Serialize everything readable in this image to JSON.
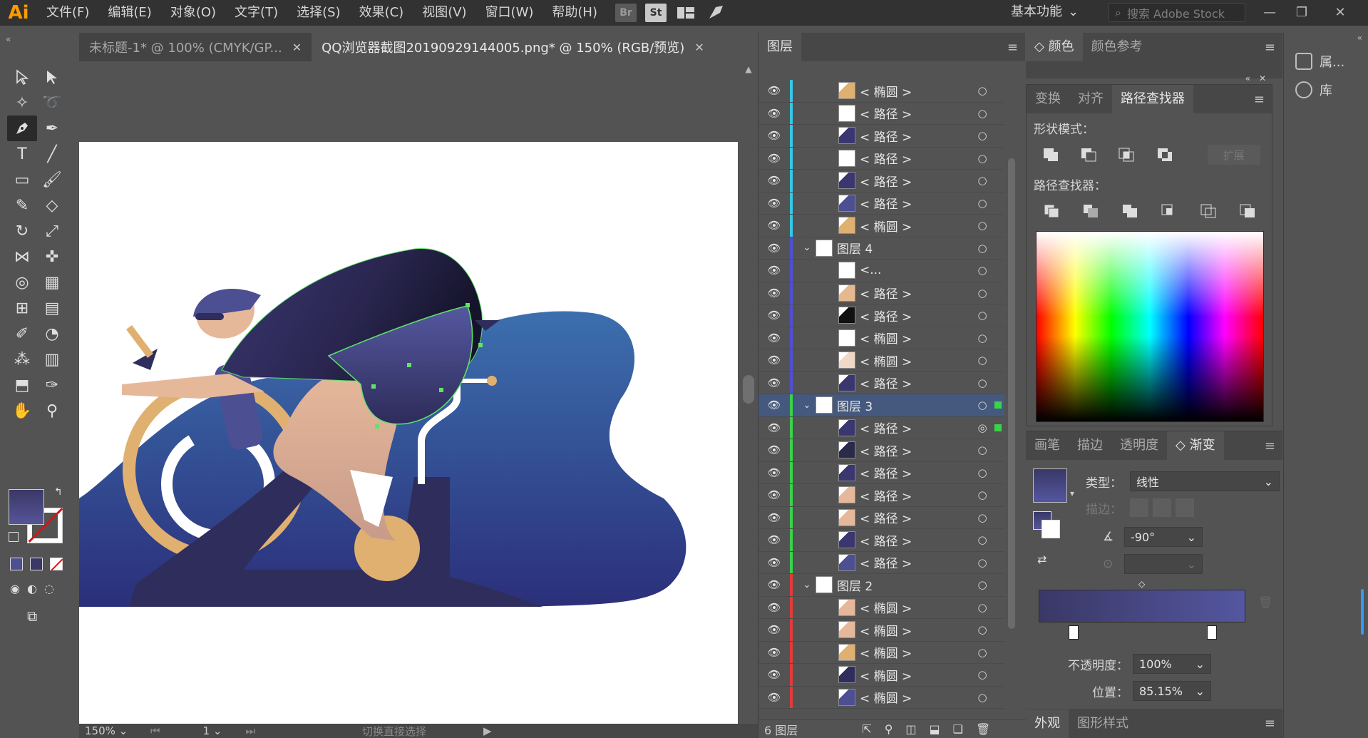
{
  "app": {
    "logo": "Ai"
  },
  "menu": [
    "文件(F)",
    "编辑(E)",
    "对象(O)",
    "文字(T)",
    "选择(S)",
    "效果(C)",
    "视图(V)",
    "窗口(W)",
    "帮助(H)"
  ],
  "menubar_icons": {
    "br": "Br",
    "st": "St"
  },
  "workspace": {
    "label": "基本功能"
  },
  "search": {
    "placeholder": "搜索 Adobe Stock"
  },
  "tabs": [
    {
      "label": "未标题-1* @ 100% (CMYK/GP...",
      "active": false
    },
    {
      "label": "QQ浏览器截图20190929144005.png* @ 150% (RGB/预览)",
      "active": true
    }
  ],
  "status": {
    "zoom": "150%",
    "page": "1",
    "text": "切换直接选择"
  },
  "layers_panel": {
    "title": "图层",
    "count": "6 图层",
    "rows": [
      {
        "name": "< 椭圆 >",
        "color": "#35c7e6",
        "thumb": "#e0b070",
        "level": 2
      },
      {
        "name": "< 路径 >",
        "color": "#35c7e6",
        "thumb": "#ffffff",
        "level": 2
      },
      {
        "name": "< 路径 >",
        "color": "#35c7e6",
        "thumb": "#3a3670",
        "level": 2
      },
      {
        "name": "< 路径 >",
        "color": "#35c7e6",
        "thumb": "#ffffff",
        "level": 2
      },
      {
        "name": "< 路径 >",
        "color": "#35c7e6",
        "thumb": "#3a3670",
        "level": 2
      },
      {
        "name": "< 路径 >",
        "color": "#35c7e6",
        "thumb": "#4c4f92",
        "level": 2
      },
      {
        "name": "< 椭圆 >",
        "color": "#35c7e6",
        "thumb": "#e0b070",
        "level": 2
      },
      {
        "name": "图层 4",
        "color": "#4f4fd6",
        "thumb": "#ffffff",
        "level": 1,
        "expanded": true
      },
      {
        "name": "<...",
        "color": "#4f4fd6",
        "thumb": "#ffffff",
        "level": 2
      },
      {
        "name": "< 路径 >",
        "color": "#4f4fd6",
        "thumb": "#e6b890",
        "level": 2
      },
      {
        "name": "< 路径 >",
        "color": "#4f4fd6",
        "thumb": "#111111",
        "level": 2
      },
      {
        "name": "< 椭圆 >",
        "color": "#4f4fd6",
        "thumb": "#ffffff",
        "level": 2
      },
      {
        "name": "< 椭圆 >",
        "color": "#4f4fd6",
        "thumb": "#f0d8c8",
        "level": 2
      },
      {
        "name": "< 路径 >",
        "color": "#4f4fd6",
        "thumb": "#3a3670",
        "level": 2
      },
      {
        "name": "图层 3",
        "color": "#39d24a",
        "thumb": "#ffffff",
        "level": 1,
        "expanded": true,
        "selected": true
      },
      {
        "name": "< 路径 >",
        "color": "#39d24a",
        "thumb": "#3a3670",
        "level": 2,
        "targeted": true
      },
      {
        "name": "< 路径 >",
        "color": "#39d24a",
        "thumb": "#2a2a4a",
        "level": 2
      },
      {
        "name": "< 路径 >",
        "color": "#39d24a",
        "thumb": "#3a3670",
        "level": 2
      },
      {
        "name": "< 路径 >",
        "color": "#39d24a",
        "thumb": "#e6b89a",
        "level": 2
      },
      {
        "name": "< 路径 >",
        "color": "#39d24a",
        "thumb": "#e6b89a",
        "level": 2
      },
      {
        "name": "< 路径 >",
        "color": "#39d24a",
        "thumb": "#3a3670",
        "level": 2
      },
      {
        "name": "< 路径 >",
        "color": "#39d24a",
        "thumb": "#4c4f92",
        "level": 2
      },
      {
        "name": "图层 2",
        "color": "#e23a3a",
        "thumb": "#ffffff",
        "level": 1,
        "expanded": true
      },
      {
        "name": "< 椭圆 >",
        "color": "#e23a3a",
        "thumb": "#e6b89a",
        "level": 2
      },
      {
        "name": "< 椭圆 >",
        "color": "#e23a3a",
        "thumb": "#e6b89a",
        "level": 2
      },
      {
        "name": "< 椭圆 >",
        "color": "#e23a3a",
        "thumb": "#e0b070",
        "level": 2
      },
      {
        "name": "< 椭圆 >",
        "color": "#e23a3a",
        "thumb": "#2f2d5c",
        "level": 2
      },
      {
        "name": "< 椭圆 >",
        "color": "#e23a3a",
        "thumb": "#4c4f92",
        "level": 2
      }
    ]
  },
  "color_panel": {
    "tab_color": "颜色",
    "tab_guide": "颜色参考"
  },
  "pathfinder": {
    "tabs": [
      "变换",
      "对齐",
      "路径查找器"
    ],
    "shape_modes_label": "形状模式：",
    "expand_label": "扩展",
    "pathfinders_label": "路径查找器："
  },
  "gradient_panel": {
    "tabs": [
      "画笔",
      "描边",
      "透明度",
      "渐变"
    ],
    "type_label": "类型：",
    "type_value": "线性",
    "stroke_label": "描边：",
    "angle_value": "-90°",
    "opacity_label": "不透明度：",
    "opacity_value": "100%",
    "position_label": "位置：",
    "position_value": "85.15%",
    "start_color": "#3a3866",
    "end_color": "#5456a0"
  },
  "appearance": {
    "tab1": "外观",
    "tab2": "图形样式"
  },
  "dock": [
    {
      "label": "属..."
    },
    {
      "label": "库"
    }
  ],
  "colors": {
    "accent_selection": "#44597d",
    "logo": "#ff9a00"
  }
}
